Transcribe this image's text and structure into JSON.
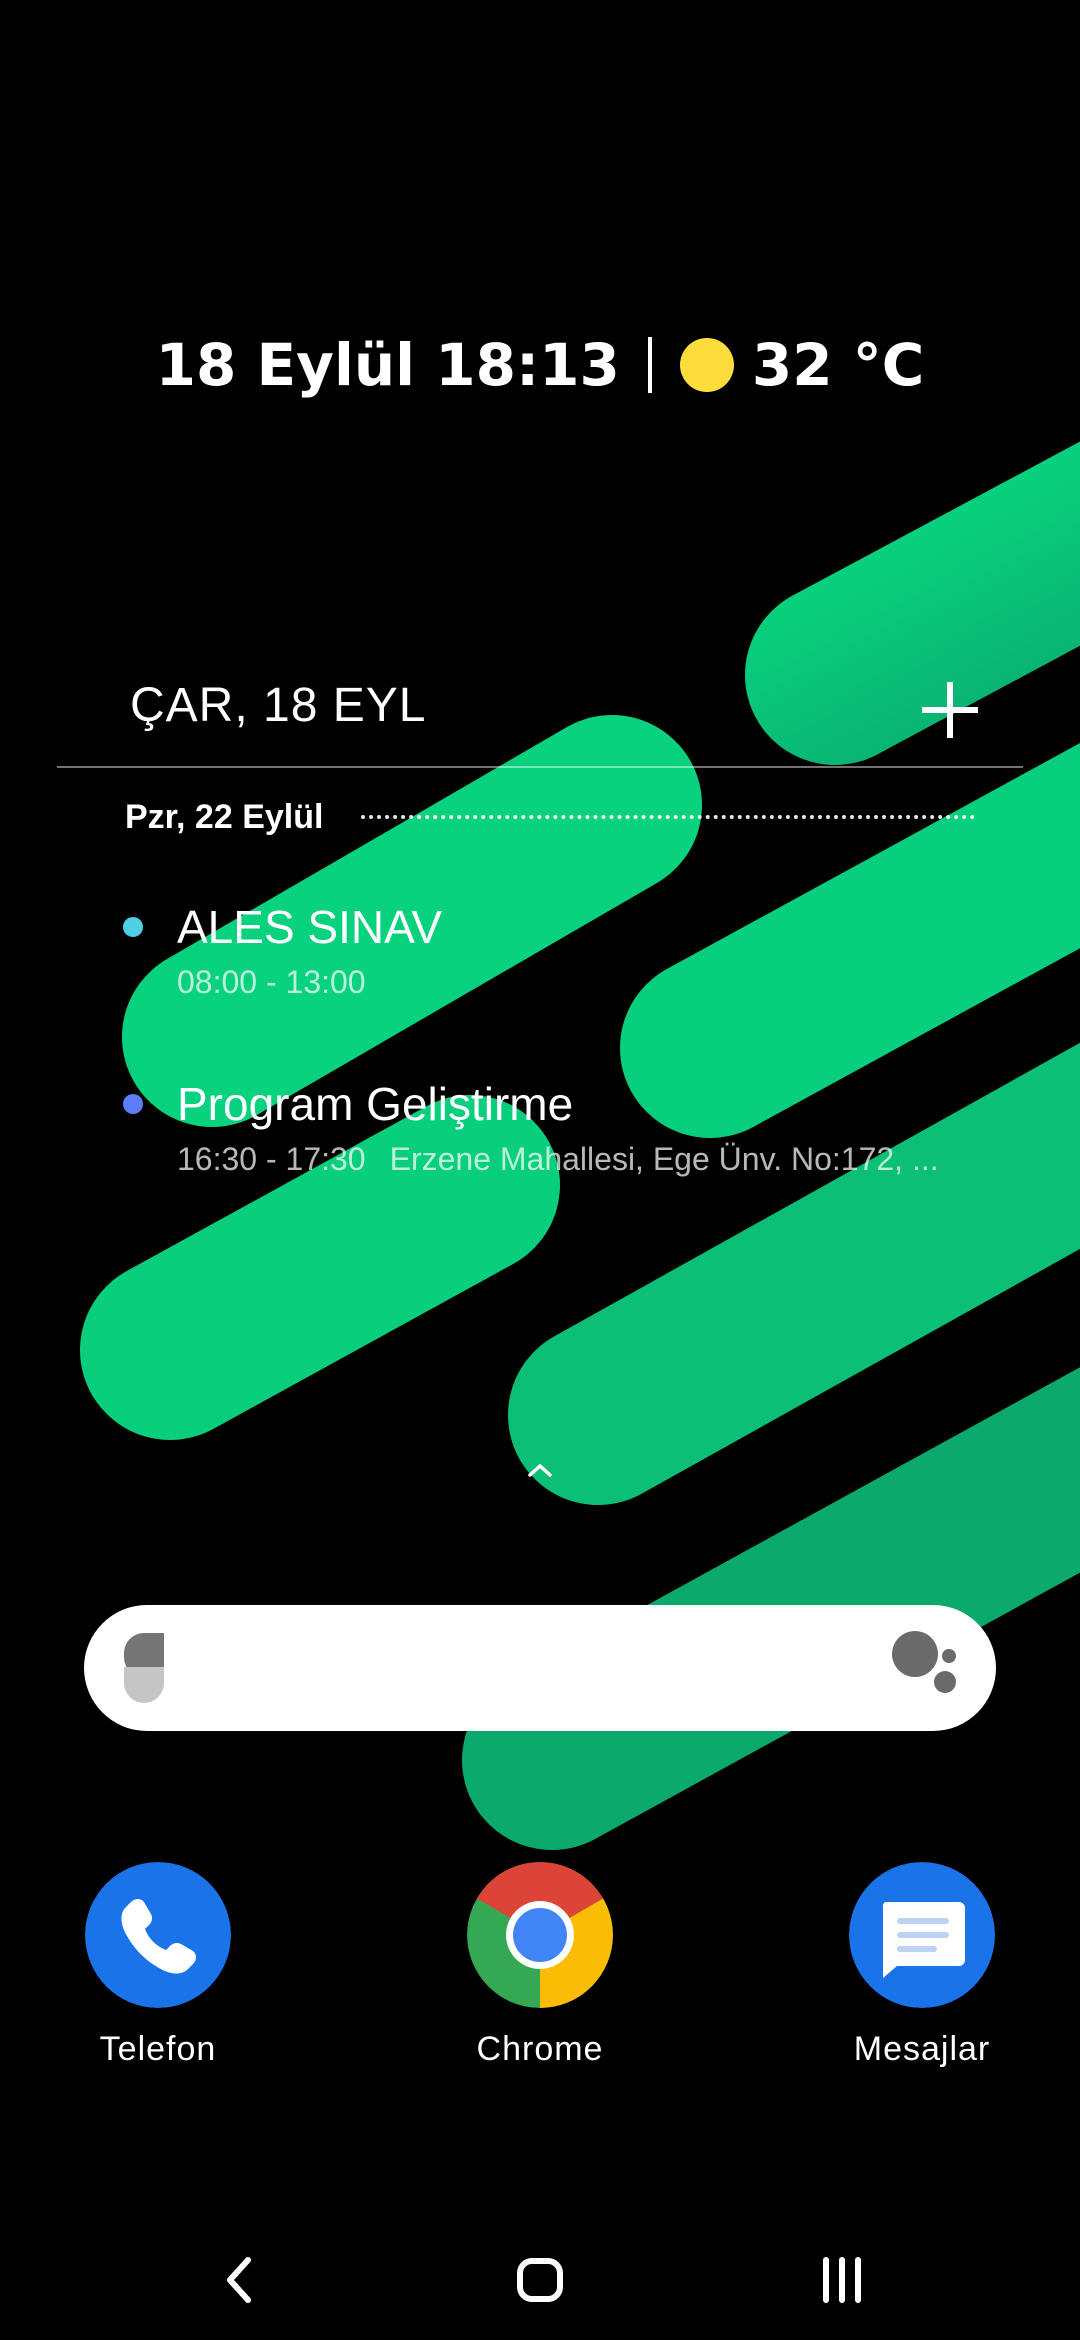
{
  "status": {
    "date_time": "18 Eylül 18:13",
    "temperature": "32 °C",
    "weather_icon": "sun-icon"
  },
  "calendar_widget": {
    "header_date": "ÇAR, 18 EYL",
    "add_icon": "plus-icon",
    "day_label": "Pzr, 22 Eylül",
    "events": [
      {
        "title": "ALES SINAV",
        "time": "08:00 - 13:00",
        "location": "",
        "dot_color": "#4dd0e1"
      },
      {
        "title": "Program Geliştirme",
        "time": "16:30 - 17:30",
        "location": "Erzene Mahallesi, Ege Ünv. No:172, ...",
        "dot_color": "#5c7cfa"
      }
    ]
  },
  "search_bar": {
    "left_icon": "google-g-icon",
    "right_icon": "google-assistant-icon"
  },
  "dock": [
    {
      "label": "Telefon",
      "icon": "phone-icon",
      "color": "#1a73e8"
    },
    {
      "label": "Chrome",
      "icon": "chrome-icon",
      "color": "#34a853"
    },
    {
      "label": "Mesajlar",
      "icon": "messages-icon",
      "color": "#1a73e8"
    }
  ],
  "navigation": {
    "back": "back-icon",
    "home": "home-icon",
    "recents": "recents-icon"
  },
  "colors": {
    "wallpaper_background": "#000000",
    "wallpaper_stripes": "#07d47f",
    "search_bar": "#ffffff"
  }
}
